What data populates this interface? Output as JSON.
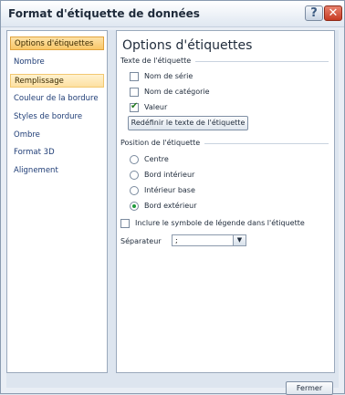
{
  "window": {
    "title": "Format d'étiquette de données",
    "help_label": "?",
    "close_label": "✕"
  },
  "sidebar": {
    "items": [
      {
        "label": "Options d'étiquettes",
        "state": "selected"
      },
      {
        "label": "Nombre",
        "state": ""
      },
      {
        "label": "Remplissage",
        "state": "hover"
      },
      {
        "label": "Couleur de la bordure",
        "state": ""
      },
      {
        "label": "Styles de bordure",
        "state": ""
      },
      {
        "label": "Ombre",
        "state": ""
      },
      {
        "label": "Format 3D",
        "state": ""
      },
      {
        "label": "Alignement",
        "state": ""
      }
    ]
  },
  "content": {
    "heading": "Options d'étiquettes",
    "text_group_label": "Texte de l'étiquette",
    "series_name_label": "Nom de série",
    "series_name_checked": false,
    "category_name_label": "Nom de catégorie",
    "category_name_checked": false,
    "value_label": "Valeur",
    "value_checked": true,
    "reset_text_label": "Redéfinir le texte de l'étiquette",
    "position_group_label": "Position de l'étiquette",
    "positions": [
      {
        "label": "Centre",
        "checked": false
      },
      {
        "label": "Bord intérieur",
        "checked": false
      },
      {
        "label": "Intérieur base",
        "checked": false
      },
      {
        "label": "Bord extérieur",
        "checked": true
      }
    ],
    "legend_key_label": "Inclure le symbole de légende dans l'étiquette",
    "legend_key_checked": false,
    "separator_label": "Séparateur",
    "separator_value": ";"
  },
  "footer": {
    "close_button_label": "Fermer"
  }
}
